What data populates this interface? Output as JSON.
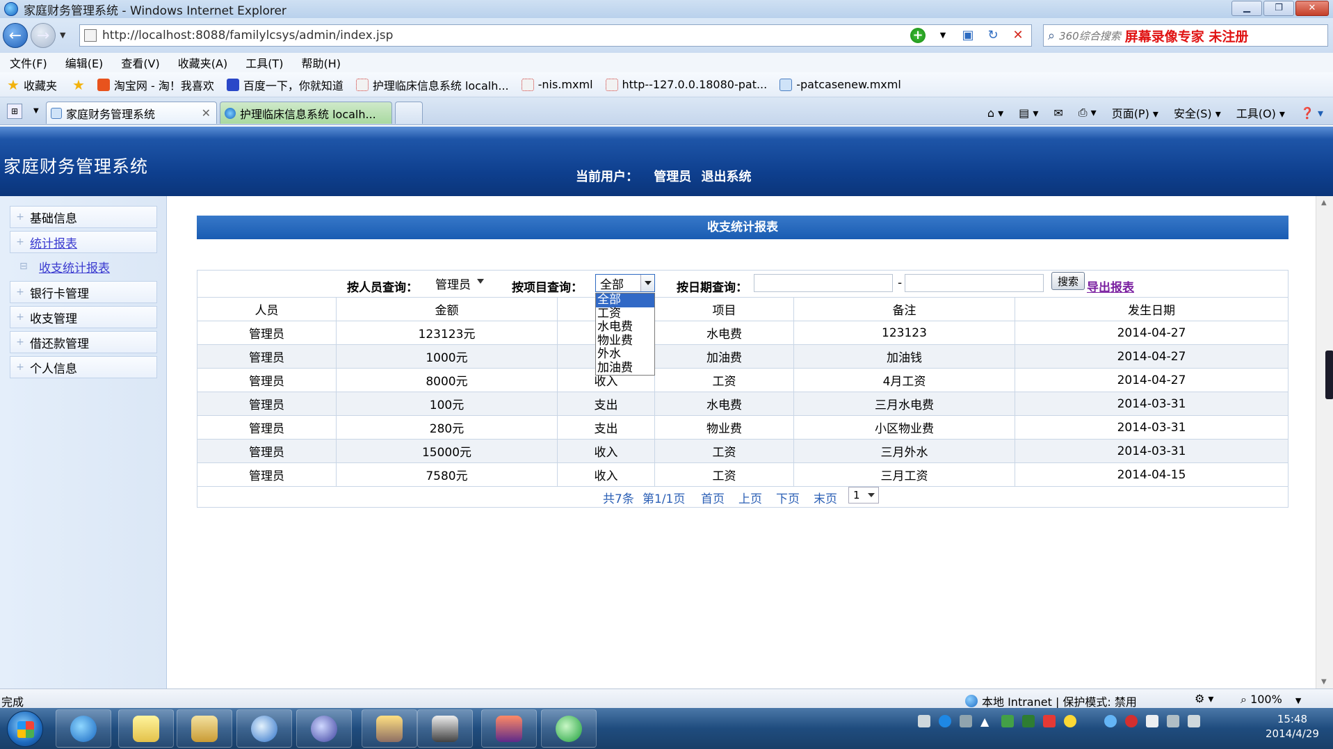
{
  "browser": {
    "window_title": "家庭财务管理系统 - Windows Internet Explorer",
    "url": "http://localhost:8088/familylcsys/admin/index.jsp",
    "search_engine": "360综合搜索",
    "search_promo": "屏幕录像专家  未注册",
    "menu": [
      "文件(F)",
      "编辑(E)",
      "查看(V)",
      "收藏夹(A)",
      "工具(T)",
      "帮助(H)"
    ],
    "favorites_label": "收藏夹",
    "favorites": [
      "淘宝网 - 淘！我喜欢",
      "百度一下，你就知道",
      "护理临床信息系统 localh...",
      "-nis.mxml",
      "http--127.0.0.18080-pat...",
      "-patcasenew.mxml"
    ],
    "tabs": [
      "家庭财务管理系统",
      "护理临床信息系统 localh..."
    ],
    "command_bar": [
      "页面(P)",
      "安全(S)",
      "工具(O)"
    ]
  },
  "app": {
    "title": "家庭财务管理系统",
    "current_user_label": "当前用户：",
    "current_user": "管理员",
    "logout": "退出系统"
  },
  "sidebar": {
    "items": [
      {
        "label": "基础信息"
      },
      {
        "label": "统计报表"
      },
      {
        "label": "收支统计报表"
      },
      {
        "label": "银行卡管理"
      },
      {
        "label": "收支管理"
      },
      {
        "label": "借还款管理"
      },
      {
        "label": "个人信息"
      }
    ]
  },
  "report": {
    "title": "收支统计报表",
    "filter": {
      "by_person_label": "按人员查询：",
      "person_value": "管理员",
      "by_item_label": "按项目查询：",
      "item_value": "全部",
      "by_date_label": "按日期查询：",
      "date_separator": "-",
      "search_button": "搜索",
      "export_link": "导出报表"
    },
    "item_options": [
      "全部",
      "工资",
      "水电费",
      "物业费",
      "外水",
      "加油费"
    ],
    "columns": [
      "人员",
      "金额",
      "",
      "项目",
      "备注",
      "发生日期"
    ],
    "rows": [
      [
        "管理员",
        "123123元",
        "",
        "水电费",
        "123123",
        "2014-04-27"
      ],
      [
        "管理员",
        "1000元",
        "",
        "加油费",
        "加油钱",
        "2014-04-27"
      ],
      [
        "管理员",
        "8000元",
        "收入",
        "工资",
        "4月工资",
        "2014-04-27"
      ],
      [
        "管理员",
        "100元",
        "支出",
        "水电费",
        "三月水电费",
        "2014-03-31"
      ],
      [
        "管理员",
        "280元",
        "支出",
        "物业费",
        "小区物业费",
        "2014-03-31"
      ],
      [
        "管理员",
        "15000元",
        "收入",
        "工资",
        "三月外水",
        "2014-03-31"
      ],
      [
        "管理员",
        "7580元",
        "收入",
        "工资",
        "三月工资",
        "2014-04-15"
      ]
    ],
    "pager": {
      "total": "共7条",
      "page_info": "第1/1页",
      "first": "首页",
      "prev": "上页",
      "next": "下页",
      "last": "末页",
      "page_value": "1"
    }
  },
  "status": {
    "text": "完成",
    "zone": "本地 Intranet | 保护模式: 禁用",
    "zoom": "100%"
  },
  "taskbar": {
    "time": "15:48",
    "date": "2014/4/29"
  }
}
